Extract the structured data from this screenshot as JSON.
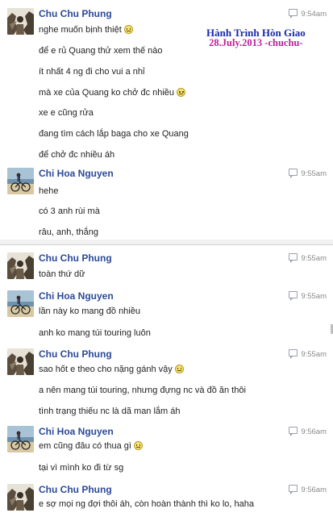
{
  "watermark": {
    "line1": "Hành Trình Hòn Giao",
    "line2": "28.July.2013 -chuchu-"
  },
  "panel_a": [
    {
      "sender": "Chu Chu Phung",
      "avatar": "rock-portrait",
      "time": "9:54am",
      "lines": [
        "nghe muốn bịnh thiệt",
        "để e rủ Quang thử xem thế nào",
        "ít nhất 4 ng đi cho vui a nhỉ",
        "mà xe của Quang ko chở đc nhiều",
        "xe e cũng rửa",
        "đang tìm cách lắp baga cho xe Quang",
        "để chở đc nhiều áh"
      ],
      "smileys": [
        0,
        3
      ]
    },
    {
      "sender": "Chi Hoa Nguyen",
      "avatar": "beach-bicycle",
      "time": "9:55am",
      "lines": [
        "hehe",
        "có 3 anh rùi mà",
        "râu, anh, thắng"
      ],
      "smileys": []
    }
  ],
  "panel_b": [
    {
      "sender": "Chu Chu Phung",
      "avatar": "rock-portrait",
      "time": "9:55am",
      "lines": [
        "toàn thứ dữ"
      ],
      "smileys": []
    },
    {
      "sender": "Chi Hoa Nguyen",
      "avatar": "beach-bicycle",
      "time": "9:55am",
      "lines": [
        "lần này ko mang đồ nhiều",
        "anh ko mang túi touring luôn"
      ],
      "smileys": []
    },
    {
      "sender": "Chu Chu Phung",
      "avatar": "rock-portrait",
      "time": "9:55am",
      "lines": [
        "sao hốt e theo cho nặng gánh vậy",
        "a nên mang túi touring, nhưng đựng nc và đồ ăn thôi",
        "tình trạng thiếu nc là dã man lắm áh"
      ],
      "smileys": [
        0
      ]
    },
    {
      "sender": "Chi Hoa Nguyen",
      "avatar": "beach-bicycle",
      "time": "9:56am",
      "lines": [
        "em cũng đâu có thua gì",
        "tại vì mình ko đi từ sg"
      ],
      "smileys": [
        0
      ]
    },
    {
      "sender": "Chu Chu Phung",
      "avatar": "rock-portrait",
      "time": "9:56am",
      "lines": [
        "e sợ mọi ng đợi thôi áh, còn hoàn thành thì ko lo, haha"
      ],
      "smileys": []
    }
  ]
}
